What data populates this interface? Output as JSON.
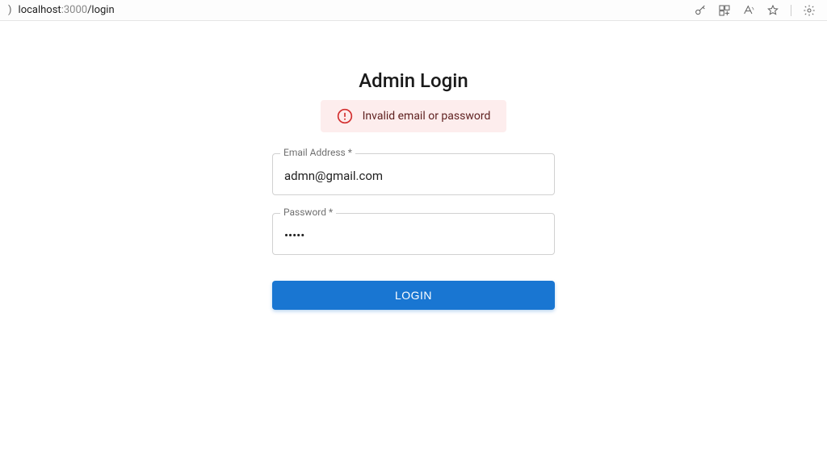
{
  "browser": {
    "url_paren": ")",
    "url_host": "localhost",
    "url_port": ":3000",
    "url_path": "/login"
  },
  "page": {
    "title": "Admin Login",
    "error_message": "Invalid email or password"
  },
  "form": {
    "email": {
      "label": "Email Address *",
      "value": "admn@gmail.com"
    },
    "password": {
      "label": "Password *",
      "value": "•••••"
    },
    "submit_label": "LOGIN"
  }
}
